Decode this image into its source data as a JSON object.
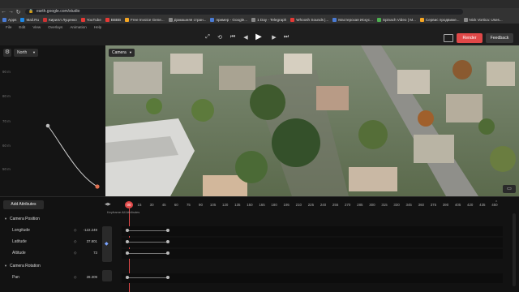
{
  "browser": {
    "url": "earth.google.com/studio",
    "bookmarks": [
      {
        "label": "Apps",
        "color": "#4a7bd4"
      },
      {
        "label": "Mail.Ru",
        "color": "#1e88e5"
      },
      {
        "label": "Кирилл Луценко",
        "color": "#c33"
      },
      {
        "label": "YouTube",
        "color": "#e53935"
      },
      {
        "label": "BBBB",
        "color": "#e53935"
      },
      {
        "label": "Free Invoice Gene...",
        "color": "#f5a623"
      },
      {
        "label": "Домашняя стран...",
        "color": "#888"
      },
      {
        "label": "пример - Google...",
        "color": "#4a7bd4"
      },
      {
        "label": "1 Day - Telegraph",
        "color": "#888"
      },
      {
        "label": "Whoosh Sounds |...",
        "color": "#e53935"
      },
      {
        "label": "Мастерская Искус...",
        "color": "#4a7bd4"
      },
      {
        "label": "Spinach Video | M...",
        "color": "#4caf50"
      },
      {
        "label": "Сервис продвиже...",
        "color": "#f5a623"
      },
      {
        "label": "Nick Vortica: Uses...",
        "color": "#888"
      }
    ]
  },
  "menu": [
    "File",
    "Edit",
    "View",
    "Overlays",
    "Animation",
    "Help"
  ],
  "toolbar": {
    "render_label": "Render",
    "feedback_label": "Feedback"
  },
  "graph": {
    "direction": "North",
    "altitude_labels": [
      "90 m",
      "80 m",
      "70 m",
      "60 m",
      "50 m"
    ]
  },
  "viewport": {
    "camera_label": "Camera"
  },
  "timeline": {
    "add_attributes_label": "Add Attributes",
    "current_frame": "00",
    "caption": "Keyframe All Attributes",
    "ticks": [
      "15",
      "30",
      "45",
      "60",
      "75",
      "90",
      "105",
      "120",
      "135",
      "150",
      "165",
      "180",
      "195",
      "210",
      "225",
      "240",
      "255",
      "270",
      "285",
      "300",
      "315",
      "330",
      "345",
      "360",
      "375",
      "390",
      "405",
      "420",
      "435",
      "450"
    ],
    "sections": [
      {
        "title": "Camera Position",
        "attributes": [
          {
            "label": "Longitude",
            "value": "-122.249"
          },
          {
            "label": "Latitude",
            "value": "37.801"
          },
          {
            "label": "Altitude",
            "value": "73"
          }
        ]
      },
      {
        "title": "Camera Rotation",
        "attributes": [
          {
            "label": "Pan",
            "value": "28.309"
          }
        ]
      }
    ]
  }
}
